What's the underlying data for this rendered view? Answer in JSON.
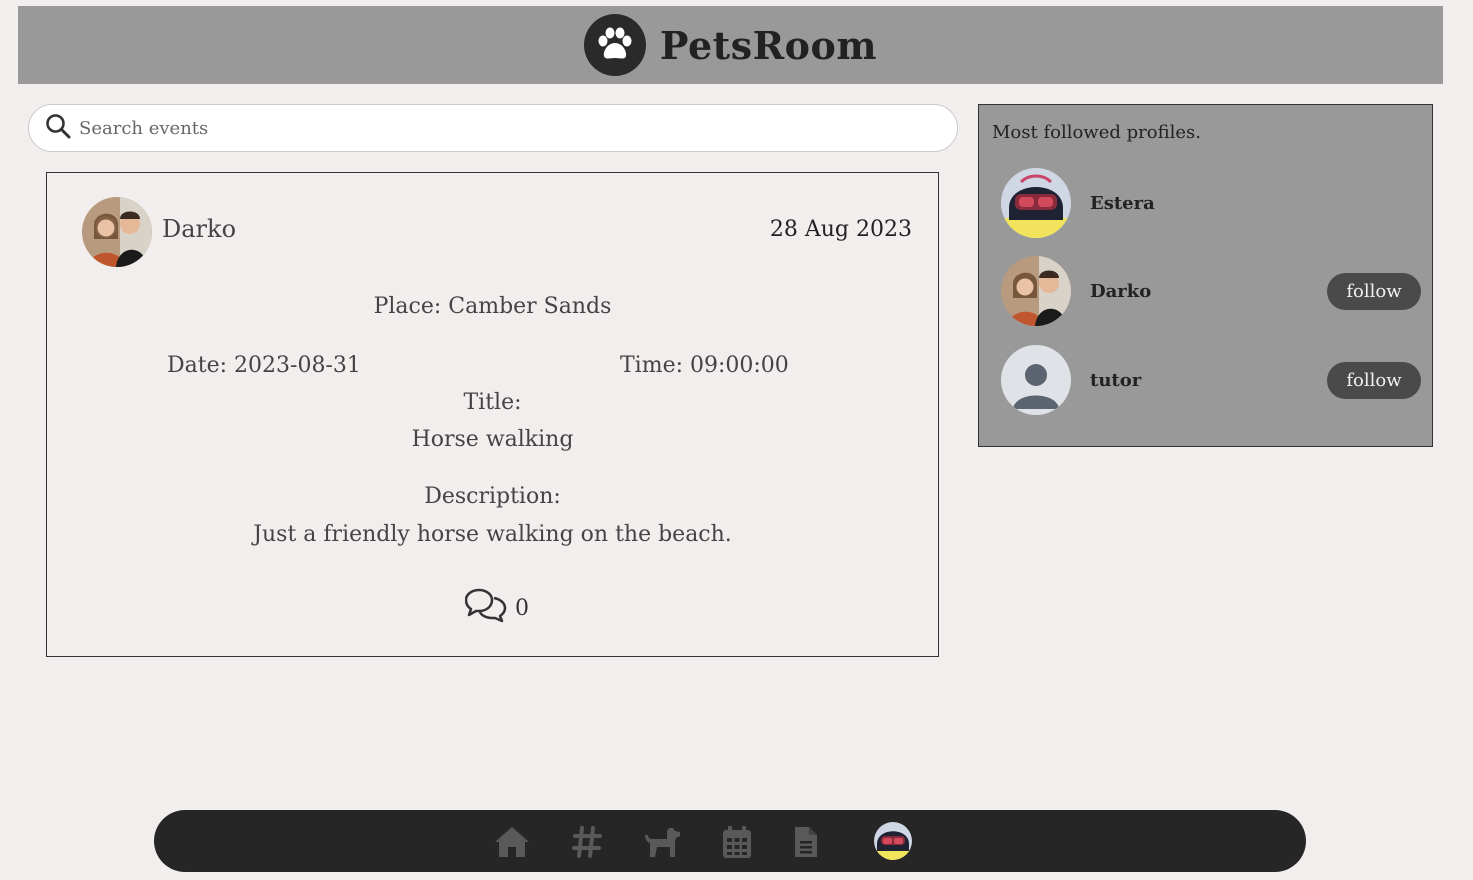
{
  "app": {
    "brand": "PetsRoom"
  },
  "search": {
    "placeholder": "Search events",
    "value": ""
  },
  "event": {
    "owner": "Darko",
    "created": "28 Aug 2023",
    "place": "Place: Camber Sands",
    "date": "Date: 2023-08-31",
    "time": "Time: 09:00:00",
    "title_label": "Title:",
    "title": "Horse walking",
    "description_label": "Description:",
    "description": "Just a friendly horse walking on the beach.",
    "comments_count": "0"
  },
  "sidebar": {
    "title": "Most followed profiles.",
    "profiles": [
      {
        "name": "Estera",
        "button": ""
      },
      {
        "name": "Darko",
        "button": "follow"
      },
      {
        "name": "tutor",
        "button": "follow"
      }
    ]
  },
  "nav": {
    "items": [
      "home-icon",
      "hashtag-icon",
      "dog-icon",
      "calendar-icon",
      "document-icon",
      "profile-avatar"
    ]
  },
  "colors": {
    "background": "#f2eeed",
    "header": "#999999",
    "navbar": "#262626",
    "nav_icon": "#595959",
    "button": "#4a4a4a"
  }
}
